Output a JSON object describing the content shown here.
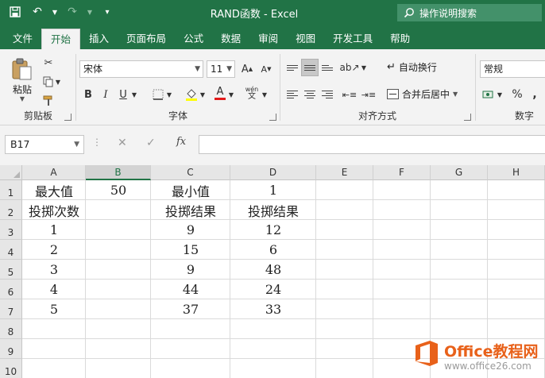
{
  "window": {
    "title": "RAND函数  -  Excel",
    "tellme_placeholder": "操作说明搜索"
  },
  "tabs": [
    {
      "label": "文件",
      "active": false
    },
    {
      "label": "开始",
      "active": true
    },
    {
      "label": "插入",
      "active": false
    },
    {
      "label": "页面布局",
      "active": false
    },
    {
      "label": "公式",
      "active": false
    },
    {
      "label": "数据",
      "active": false
    },
    {
      "label": "审阅",
      "active": false
    },
    {
      "label": "视图",
      "active": false
    },
    {
      "label": "开发工具",
      "active": false
    },
    {
      "label": "帮助",
      "active": false
    }
  ],
  "ribbon": {
    "clipboard": {
      "label": "剪贴板",
      "paste_label": "粘贴"
    },
    "font": {
      "label": "字体",
      "font_name": "宋体",
      "font_size": "11",
      "bold": "B",
      "italic": "I",
      "underline": "U",
      "phonetic": "wén",
      "grow": "A",
      "shrink": "A",
      "font_color_glyph": "A"
    },
    "alignment": {
      "label": "对齐方式",
      "wrap_text": "自动换行",
      "merge_center": "合并后居中"
    },
    "number": {
      "label": "数字",
      "format": "常规",
      "percent": "%",
      "comma": ","
    }
  },
  "formula_bar": {
    "name_box": "B17",
    "formula": "",
    "fx": "fx"
  },
  "sheet": {
    "columns": [
      "A",
      "B",
      "C",
      "D",
      "E",
      "F",
      "G",
      "H"
    ],
    "rows": [
      "1",
      "2",
      "3",
      "4",
      "5",
      "6",
      "7",
      "8",
      "9",
      "10"
    ],
    "selected_column": "B",
    "cells": [
      [
        "最大值",
        "50",
        "最小值",
        "1"
      ],
      [
        "投掷次数",
        "",
        "投掷结果",
        "投掷结果"
      ],
      [
        "1",
        "",
        "9",
        "12"
      ],
      [
        "2",
        "",
        "15",
        "6"
      ],
      [
        "3",
        "",
        "9",
        "48"
      ],
      [
        "4",
        "",
        "44",
        "24"
      ],
      [
        "5",
        "",
        "37",
        "33"
      ]
    ]
  },
  "watermark": {
    "brand": "Office教程网",
    "url": "www.office26.com"
  },
  "colors": {
    "excel_green": "#217346",
    "watermark_orange": "#e8611a"
  }
}
